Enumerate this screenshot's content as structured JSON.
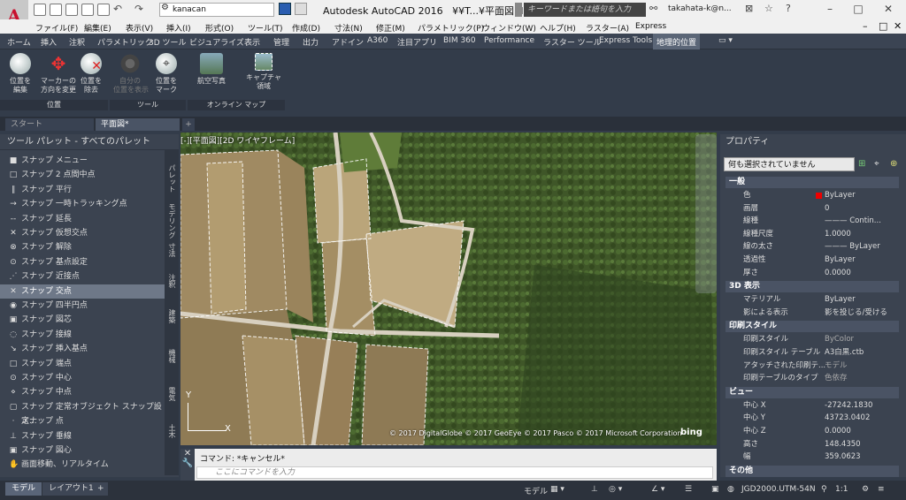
{
  "app": {
    "logo": "A",
    "title": "Autodesk AutoCAD 2016",
    "file": "¥¥T...¥平面図.dwg",
    "workspace": "kanacan",
    "search_placeholder": "キーワードまたは語句を入力",
    "user": "takahata-k@n..."
  },
  "menu": [
    "ファイル(F)",
    "編集(E)",
    "表示(V)",
    "挿入(I)",
    "形式(O)",
    "ツール(T)",
    "作成(D)",
    "寸法(N)",
    "修正(M)",
    "パラメトリック(P)",
    "ウィンドウ(W)",
    "ヘルプ(H)",
    "ラスター(A)",
    "Express"
  ],
  "ribbon_tabs": [
    "ホーム",
    "挿入",
    "注釈",
    "パラメトリック",
    "3D ツール",
    "ビジュアライズ",
    "表示",
    "管理",
    "出力",
    "アドイン",
    "A360",
    "注目アプリ",
    "BIM 360",
    "Performance",
    "ラスター ツール",
    "Express Tools",
    "地理的位置"
  ],
  "ribbon_buttons": [
    {
      "label": "位置を\n編集",
      "icon": "globe-edit-icon"
    },
    {
      "label": "マーカーの\n方向を変更",
      "icon": "marker-orient-icon"
    },
    {
      "label": "位置を\n除去",
      "icon": "globe-remove-icon"
    },
    {
      "label": "自分の\n位置を表示",
      "icon": "my-location-icon",
      "disabled": true
    },
    {
      "label": "位置を\nマーク",
      "icon": "mark-location-icon"
    },
    {
      "label": "航空写真",
      "icon": "aerial-photo-icon"
    },
    {
      "label": "キャプチャ\n領域",
      "icon": "capture-area-icon"
    }
  ],
  "ribbon_panels": [
    "位置",
    "ツール",
    "オンライン マップ"
  ],
  "doc_tabs": [
    "スタート",
    "平面図*"
  ],
  "palette": {
    "title": "ツール パレット - すべてのパレット",
    "items": [
      "スナップ メニュー",
      "スナップ 2 点間中点",
      "スナップ 平行",
      "スナップ 一時トラッキング点",
      "スナップ 延長",
      "スナップ 仮想交点",
      "スナップ 解除",
      "スナップ 基点設定",
      "スナップ 近接点",
      "スナップ 交点",
      "スナップ 四半円点",
      "スナップ 図芯",
      "スナップ 接線",
      "スナップ 挿入基点",
      "スナップ 端点",
      "スナップ 中心",
      "スナップ 中点",
      "スナップ 定常オブジェクト スナップ設定...",
      "スナップ 点",
      "スナップ 垂線",
      "スナップ 図心",
      "画面移動、リアルタイム"
    ],
    "selected": 9,
    "vtabs": [
      "パレット",
      "モデリング",
      "寸法",
      "注釈",
      "建築",
      "機械",
      "電気",
      "土木"
    ]
  },
  "map": {
    "viewport_label": "[-][平面図][2D ワイヤフレーム]",
    "copyright": "© 2017 DigitalGlobe © 2017 GeoEye © 2017 Pasco © 2017 Microsoft Corporation",
    "bing": "bing",
    "ucs_x": "X",
    "ucs_y": "Y"
  },
  "command": {
    "history": "コマンド: *キャンセル*",
    "placeholder": "ここにコマンドを入力"
  },
  "properties": {
    "title": "プロパティ",
    "selection": "何も選択されていません",
    "sections": [
      {
        "name": "一般",
        "rows": [
          [
            "色",
            "ByLayer"
          ],
          [
            "画層",
            "0"
          ],
          [
            "線種",
            "——— Contin..."
          ],
          [
            "線種尺度",
            "1.0000"
          ],
          [
            "線の太さ",
            "——— ByLayer"
          ],
          [
            "透過性",
            "ByLayer"
          ],
          [
            "厚さ",
            "0.0000"
          ]
        ]
      },
      {
        "name": "3D 表示",
        "rows": [
          [
            "マテリアル",
            "ByLayer"
          ],
          [
            "影による表示",
            "影を投じる/受ける"
          ]
        ]
      },
      {
        "name": "印刷スタイル",
        "rows": [
          [
            "印刷スタイル",
            "ByColor"
          ],
          [
            "印刷スタイル テーブル",
            "A3白黒.ctb"
          ],
          [
            "アタッチされた印刷テ...",
            "モデル"
          ],
          [
            "印刷テーブルのタイプ",
            "色依存"
          ]
        ]
      },
      {
        "name": "ビュー",
        "rows": [
          [
            "中心 X",
            "-27242.1830"
          ],
          [
            "中心 Y",
            "43723.0402"
          ],
          [
            "中心 Z",
            "0.0000"
          ],
          [
            "高さ",
            "148.4350"
          ],
          [
            "幅",
            "359.0623"
          ]
        ]
      },
      {
        "name": "その他",
        "rows": []
      }
    ]
  },
  "status": {
    "tabs": [
      "モデル",
      "レイアウト1"
    ],
    "model_label": "モデル",
    "coord_system": "JGD2000.UTM-54N",
    "scale": "1:1"
  }
}
